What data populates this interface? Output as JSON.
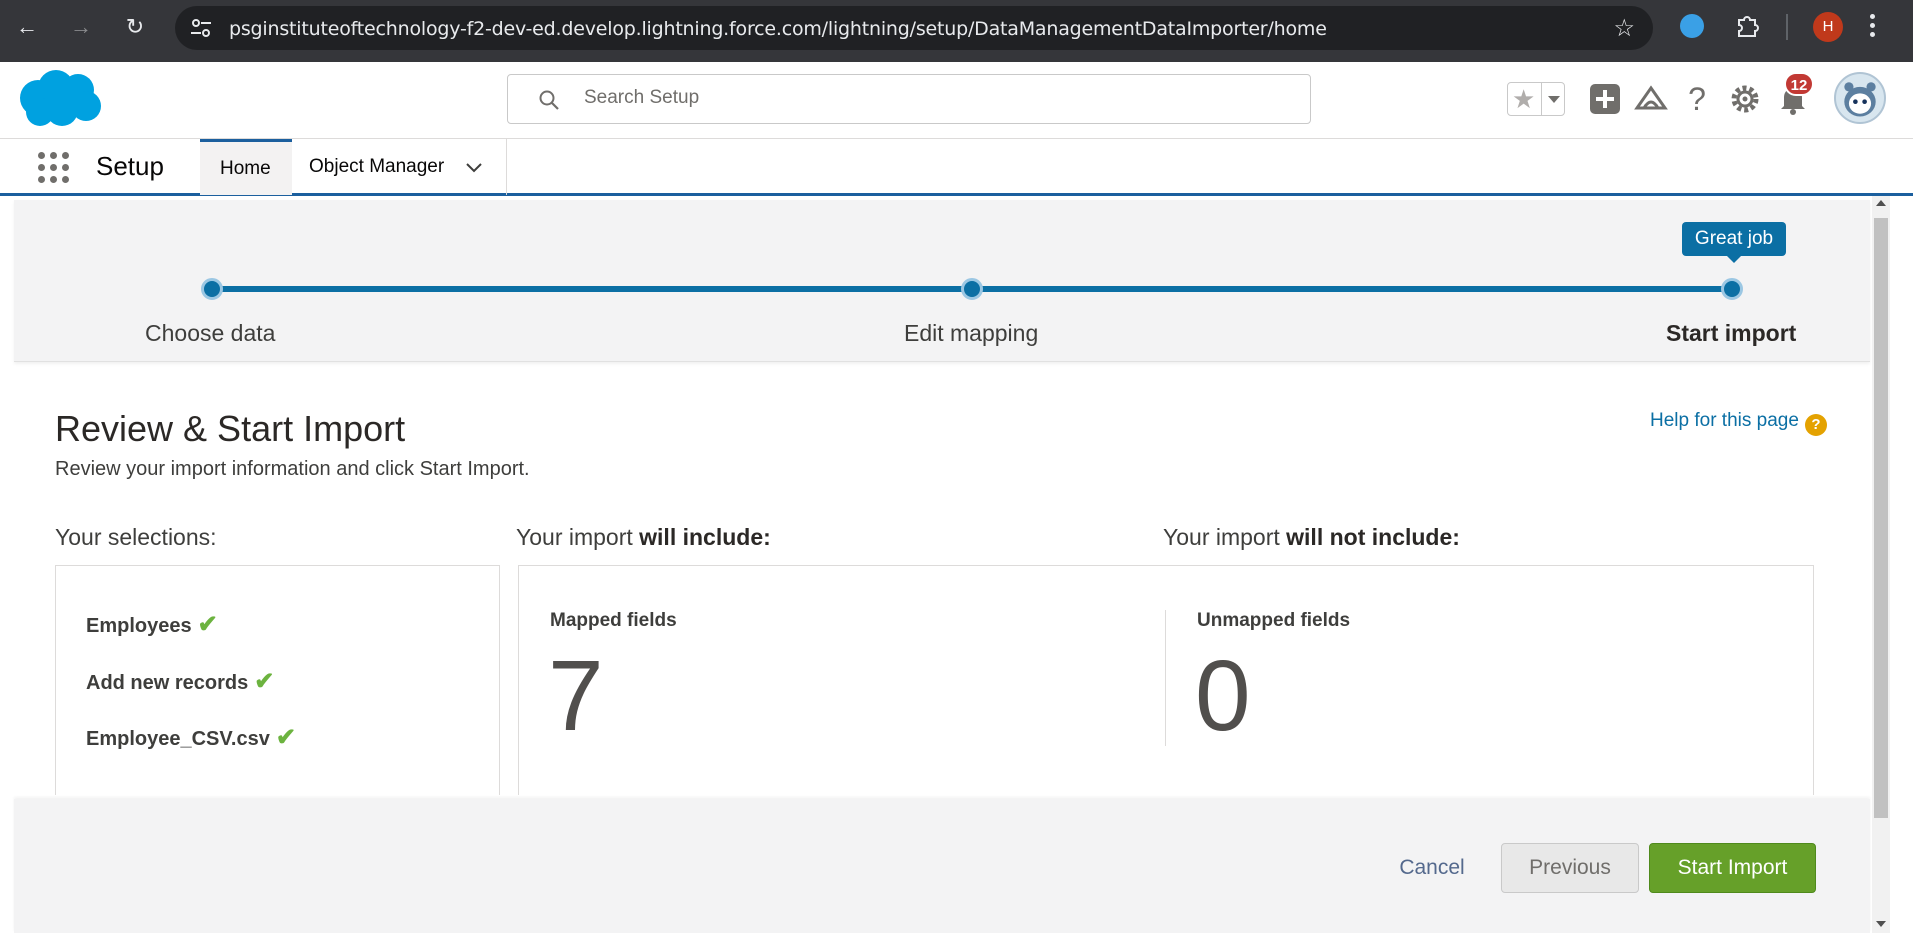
{
  "browser": {
    "url": "psginstituteoftechnology-f2-dev-ed.develop.lightning.force.com/lightning/setup/DataManagementDataImporter/home",
    "profile_initial": "H"
  },
  "header": {
    "search_placeholder": "Search Setup",
    "notification_count": "12"
  },
  "context_bar": {
    "app_name": "Setup",
    "tabs": [
      {
        "label": "Home"
      },
      {
        "label": "Object Manager"
      }
    ]
  },
  "wizard": {
    "tooltip": "Great job",
    "steps": [
      {
        "label": "Choose data"
      },
      {
        "label": "Edit mapping"
      },
      {
        "label": "Start import"
      }
    ],
    "current_step": 3
  },
  "page": {
    "title": "Review & Start Import",
    "subtitle": "Review your import information and click Start Import.",
    "help_link": "Help for this page",
    "selections_label": "Your selections:",
    "include_prefix": "Your import ",
    "include_bold": "will include:",
    "exclude_prefix": "Your import ",
    "exclude_bold": "will not include:",
    "selections": [
      {
        "label": "Employees"
      },
      {
        "label": "Add new records"
      },
      {
        "label": "Employee_CSV.csv"
      }
    ],
    "mapped_label": "Mapped fields",
    "mapped_value": "7",
    "unmapped_label": "Unmapped fields",
    "unmapped_value": "0"
  },
  "footer": {
    "cancel": "Cancel",
    "previous": "Previous",
    "start": "Start Import"
  },
  "colors": {
    "brand_blue": "#0b6fa4",
    "start_button": "#66a029",
    "check_green": "#6cb33f",
    "badge_red": "#c23934"
  }
}
